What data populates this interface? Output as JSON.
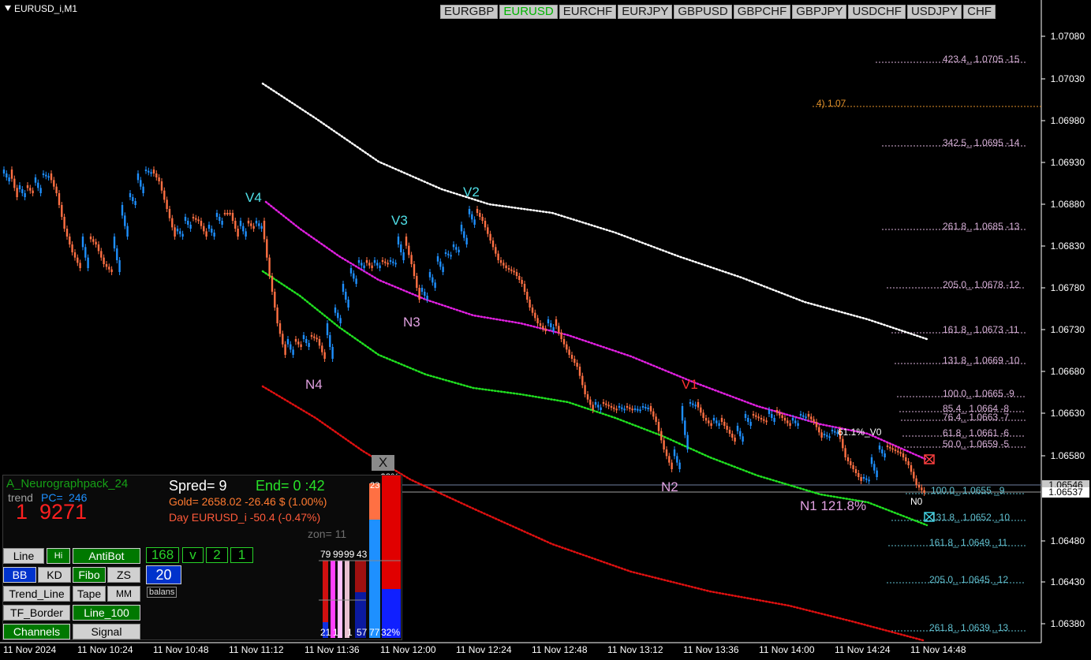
{
  "window": {
    "title": "EURUSD_i,M1"
  },
  "symbols": [
    {
      "label": "EURGBP",
      "active": false
    },
    {
      "label": "EURUSD",
      "active": true
    },
    {
      "label": "EURCHF",
      "active": false
    },
    {
      "label": "EURJPY",
      "active": false
    },
    {
      "label": "GBPUSD",
      "active": false
    },
    {
      "label": "GBPCHF",
      "active": false
    },
    {
      "label": "GBPJPY",
      "active": false
    },
    {
      "label": "USDCHF",
      "active": false
    },
    {
      "label": "USDJPY",
      "active": false
    },
    {
      "label": "CHF",
      "active": false
    }
  ],
  "price_axis": [
    "1.07080",
    "1.07030",
    "1.06980",
    "1.06930",
    "1.06880",
    "1.06830",
    "1.06780",
    "1.06730",
    "1.06680",
    "1.06630",
    "1.06580",
    "1.06480",
    "1.06430",
    "1.06380"
  ],
  "current_prices": {
    "upper": "1.06546",
    "lower": "1.06537"
  },
  "time_axis": [
    "11 Nov 2024",
    "11 Nov 10:24",
    "11 Nov 10:48",
    "11 Nov 11:12",
    "11 Nov 11:36",
    "11 Nov 12:00",
    "11 Nov 12:24",
    "11 Nov 12:48",
    "11 Nov 13:12",
    "11 Nov 13:36",
    "11 Nov 14:00",
    "11 Nov 14:24",
    "11 Nov 14:48"
  ],
  "fibo_levels": [
    {
      "text": "423.4_ 1.0705 -15",
      "color": "#d8b0d8"
    },
    {
      "text": "4) 1.07",
      "color": "#e0902a"
    },
    {
      "text": "342.5_ 1.0695 -14",
      "color": "#d8b0d8"
    },
    {
      "text": "261.8_ 1.0685 -13",
      "color": "#d8b0d8"
    },
    {
      "text": "205.0_ 1.0678 -12",
      "color": "#d8b0d8"
    },
    {
      "text": "161.8_ 1.0673 -11",
      "color": "#d8b0d8"
    },
    {
      "text": "131.8_ 1.0669 -10",
      "color": "#d8b0d8"
    },
    {
      "text": "100.0_ 1.0665 -9",
      "color": "#d8b0d8"
    },
    {
      "text": "85.4_ 1.0664 -8",
      "color": "#d8b0d8"
    },
    {
      "text": "76.4_ 1.0663 -7",
      "color": "#d8b0d8"
    },
    {
      "text": "61.8_ 1.0661 -6",
      "color": "#d8b0d8"
    },
    {
      "text": "50.0_ 1.0659 -5",
      "color": "#d8b0d8"
    },
    {
      "text": "100.0_ 1.0655 _9",
      "color": "#60c0d0"
    },
    {
      "text": "131.8_ 1.0652 _10",
      "color": "#60c0d0"
    },
    {
      "text": "161.8_ 1.0649 _11",
      "color": "#60c0d0"
    },
    {
      "text": "205.0_ 1.0645 _12",
      "color": "#60c0d0"
    },
    {
      "text": "261.8_ 1.0639 _13",
      "color": "#60c0d0"
    }
  ],
  "waves": [
    {
      "text": "V4",
      "color": "#50e0e8"
    },
    {
      "text": "V3",
      "color": "#50e0e8"
    },
    {
      "text": "V2",
      "color": "#50e0e8"
    },
    {
      "text": "V1",
      "color": "#ff3030"
    },
    {
      "text": "N3",
      "color": "#e0a0e0"
    },
    {
      "text": "N4",
      "color": "#e0a0e0"
    },
    {
      "text": "N2",
      "color": "#e0a0e0"
    },
    {
      "text": "N1 121.8%",
      "color": "#e0a0e0"
    },
    {
      "text": "N0",
      "color": "#ffffff"
    },
    {
      "text": "61.1%_V0",
      "color": "#ffffff"
    }
  ],
  "panel": {
    "name": "A_Neurographpack_24",
    "trend_label": "trend",
    "pc_label": "PC=",
    "pc_value": "246",
    "big_left": "1",
    "big_right": "9271",
    "spread": "Spred= 9",
    "end": "End= 0 :42",
    "gold": "Gold= 2658.02 -26.46 $ (1.00%)",
    "day": "Day EURUSD_i   -50.4 (-0.47%)",
    "zon": "zon= 11",
    "buttons": {
      "line": "Line",
      "hi": "Hi",
      "antibot": "AntiBot",
      "bb": "BB",
      "kd": "KD",
      "fibo": "Fibo",
      "zs": "ZS",
      "trend_line": "Trend_Line",
      "tape": "Tape",
      "mm": "MM",
      "tf_border": "TF_Border",
      "line_100": "Line_100",
      "channels": "Channels",
      "signal": "Signal"
    },
    "counters": [
      "168",
      "v",
      "2",
      "1"
    ],
    "balans_value": "20",
    "balans_label": "balans",
    "close": "X",
    "bars_top": [
      "79",
      "99",
      "99",
      "43"
    ],
    "bars_bottom": [
      "21",
      "1",
      "1",
      "57",
      "77",
      "32%"
    ],
    "bar_pct_top": "68%",
    "bar_23": "23"
  },
  "colors": {
    "bull": "#1e90ff",
    "bear": "#ff7043",
    "ma_white": "#ffffff",
    "ma_magenta": "#e020e0",
    "ma_green": "#20e020",
    "ma_red": "#e01010"
  }
}
